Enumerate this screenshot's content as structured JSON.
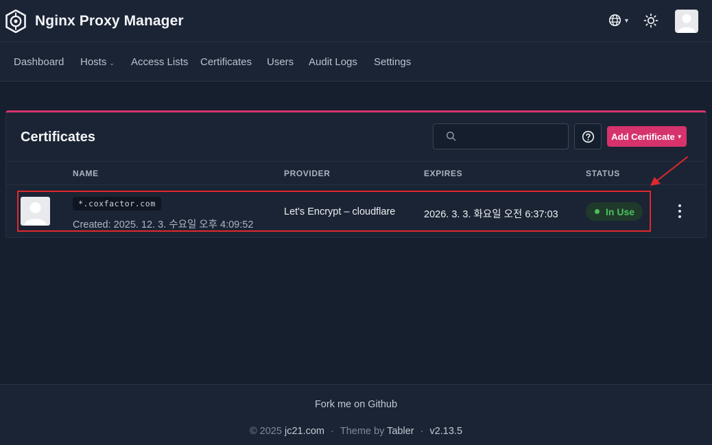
{
  "app": {
    "title": "Nginx Proxy Manager"
  },
  "nav": {
    "items": [
      {
        "label": "Dashboard"
      },
      {
        "label": "Hosts"
      },
      {
        "label": "Access Lists"
      },
      {
        "label": "Certificates"
      },
      {
        "label": "Users"
      },
      {
        "label": "Audit Logs"
      },
      {
        "label": "Settings"
      }
    ]
  },
  "icons": {
    "logo": "hexagon-logo-icon",
    "language": "globe-icon",
    "theme": "sun-icon",
    "user": "user-avatar-icon",
    "search": "search-icon",
    "help": "help-circle-icon",
    "more": "kebab-menu-icon"
  },
  "card": {
    "title": "Certificates",
    "search_placeholder": "",
    "add_button": "Add Certificate"
  },
  "table": {
    "headers": {
      "name": "NAME",
      "provider": "PROVIDER",
      "expires": "EXPIRES",
      "status": "STATUS"
    },
    "rows": [
      {
        "domain": "*.coxfactor.com",
        "created": "Created: 2025. 12. 3. 수요일 오후 4:09:52",
        "provider": "Let's Encrypt – cloudflare",
        "expires": "2026. 3. 3. 화요일 오전 6:37:03",
        "status": "In Use"
      }
    ]
  },
  "footer": {
    "fork": "Fork me on Github",
    "copyright": "© 2025",
    "copyright_link": "jc21.com",
    "theme_prefix": "Theme by",
    "theme_link": "Tabler",
    "version": "v2.13.5"
  },
  "colors": {
    "accent": "#d6336c",
    "status_ok": "#4cc15d",
    "annotation": "#e0282e"
  }
}
